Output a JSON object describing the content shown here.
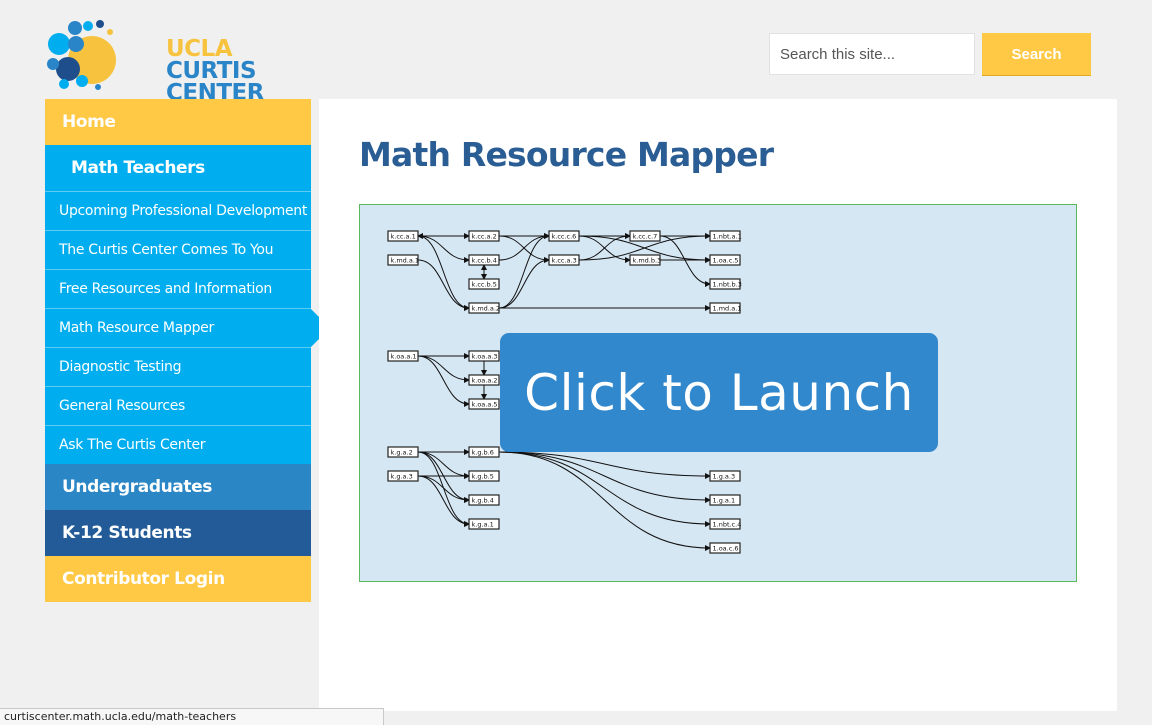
{
  "logo": {
    "line1": "UCLA",
    "line2": "CURTIS",
    "line3": "CENTER",
    "colors": {
      "yellow": "#f7c33f",
      "blue": "#2a85c8",
      "navy": "#1e4f8c",
      "sky": "#00aeef"
    }
  },
  "search": {
    "placeholder": "Search this site...",
    "button": "Search"
  },
  "nav": {
    "home": "Home",
    "math_teachers": "Math Teachers",
    "sub_items": [
      "Upcoming Professional Development",
      "The Curtis Center Comes To You",
      "Free Resources and Information",
      "Math Resource Mapper",
      "Diagnostic Testing",
      "General Resources",
      "Ask The Curtis Center"
    ],
    "undergraduates": "Undergraduates",
    "k12": "K-12 Students",
    "contributor": "Contributor Login"
  },
  "page": {
    "title": "Math Resource Mapper",
    "launch": "Click to Launch"
  },
  "graph": {
    "nodes": [
      {
        "id": "k.cc.a.1",
        "col": 0,
        "row": 0
      },
      {
        "id": "k.md.a.1",
        "col": 0,
        "row": 1
      },
      {
        "id": "k.cc.a.2",
        "col": 1,
        "row": 0
      },
      {
        "id": "k.cc.b.4",
        "col": 1,
        "row": 1
      },
      {
        "id": "k.cc.b.5",
        "col": 1,
        "row": 2
      },
      {
        "id": "k.md.a.2",
        "col": 1,
        "row": 3
      },
      {
        "id": "k.cc.c.6",
        "col": 2,
        "row": 0
      },
      {
        "id": "k.cc.a.3",
        "col": 2,
        "row": 1
      },
      {
        "id": "k.cc.c.7",
        "col": 3,
        "row": 0
      },
      {
        "id": "k.md.b.3",
        "col": 3,
        "row": 1
      },
      {
        "id": "1.nbt.a.1",
        "col": 4,
        "row": 0
      },
      {
        "id": "1.oa.c.5",
        "col": 4,
        "row": 1
      },
      {
        "id": "1.nbt.b.3",
        "col": 4,
        "row": 2
      },
      {
        "id": "1.md.a.1",
        "col": 4,
        "row": 3
      },
      {
        "id": "k.oa.a.1",
        "col": 0,
        "row": 5
      },
      {
        "id": "k.oa.a.3",
        "col": 1,
        "row": 5
      },
      {
        "id": "k.oa.a.2",
        "col": 1,
        "row": 6
      },
      {
        "id": "k.oa.a.5",
        "col": 1,
        "row": 7
      },
      {
        "id": "k.g.a.2",
        "col": 0,
        "row": 9
      },
      {
        "id": "k.g.a.3",
        "col": 0,
        "row": 10
      },
      {
        "id": "k.g.b.6",
        "col": 1,
        "row": 9
      },
      {
        "id": "k.g.b.5",
        "col": 1,
        "row": 10
      },
      {
        "id": "k.g.b.4",
        "col": 1,
        "row": 11
      },
      {
        "id": "k.g.a.1",
        "col": 1,
        "row": 12
      },
      {
        "id": "1.g.a.3",
        "col": 4,
        "row": 10
      },
      {
        "id": "1.g.a.1",
        "col": 4,
        "row": 11
      },
      {
        "id": "1.nbt.c.4",
        "col": 4,
        "row": 12
      },
      {
        "id": "1.oa.c.6",
        "col": 4,
        "row": 13
      }
    ],
    "edges": [
      [
        "k.cc.a.1",
        "k.cc.a.2"
      ],
      [
        "k.cc.a.2",
        "k.cc.a.1"
      ],
      [
        "k.cc.a.1",
        "k.cc.b.4"
      ],
      [
        "k.cc.a.1",
        "k.md.a.2"
      ],
      [
        "k.md.a.1",
        "k.md.a.2"
      ],
      [
        "k.cc.a.2",
        "k.cc.c.6"
      ],
      [
        "k.cc.a.2",
        "k.cc.a.3"
      ],
      [
        "k.cc.b.4",
        "k.cc.c.6"
      ],
      [
        "k.cc.b.4",
        "k.cc.b.5"
      ],
      [
        "k.cc.b.5",
        "k.cc.b.4"
      ],
      [
        "k.md.a.2",
        "k.cc.c.6"
      ],
      [
        "k.md.a.2",
        "k.cc.a.3"
      ],
      [
        "k.md.a.2",
        "1.md.a.1"
      ],
      [
        "k.cc.c.6",
        "k.cc.c.7"
      ],
      [
        "k.cc.c.6",
        "k.md.b.3"
      ],
      [
        "k.cc.a.3",
        "k.cc.c.7"
      ],
      [
        "k.cc.a.3",
        "1.nbt.a.1"
      ],
      [
        "k.cc.c.6",
        "1.oa.c.5"
      ],
      [
        "k.cc.c.7",
        "1.nbt.a.1"
      ],
      [
        "k.cc.c.7",
        "1.nbt.b.3"
      ],
      [
        "k.md.b.3",
        "1.oa.c.5"
      ],
      [
        "k.oa.a.1",
        "k.oa.a.3"
      ],
      [
        "k.oa.a.1",
        "k.oa.a.2"
      ],
      [
        "k.oa.a.1",
        "k.oa.a.5"
      ],
      [
        "k.oa.a.3",
        "k.oa.a.2"
      ],
      [
        "k.oa.a.2",
        "k.oa.a.5"
      ],
      [
        "k.g.a.2",
        "k.g.b.6"
      ],
      [
        "k.g.a.2",
        "k.g.b.5"
      ],
      [
        "k.g.a.2",
        "k.g.b.4"
      ],
      [
        "k.g.a.2",
        "k.g.a.1"
      ],
      [
        "k.g.a.3",
        "k.g.b.4"
      ],
      [
        "k.g.a.3",
        "k.g.a.1"
      ],
      [
        "k.g.a.3",
        "k.g.b.5"
      ],
      [
        "k.g.b.6",
        "1.g.a.3"
      ],
      [
        "k.g.b.6",
        "1.g.a.1"
      ],
      [
        "k.g.b.6",
        "1.nbt.c.4"
      ],
      [
        "k.g.b.6",
        "1.oa.c.6"
      ]
    ]
  },
  "status_bar": {
    "url": "curtiscenter.math.ucla.edu/math-teachers"
  }
}
